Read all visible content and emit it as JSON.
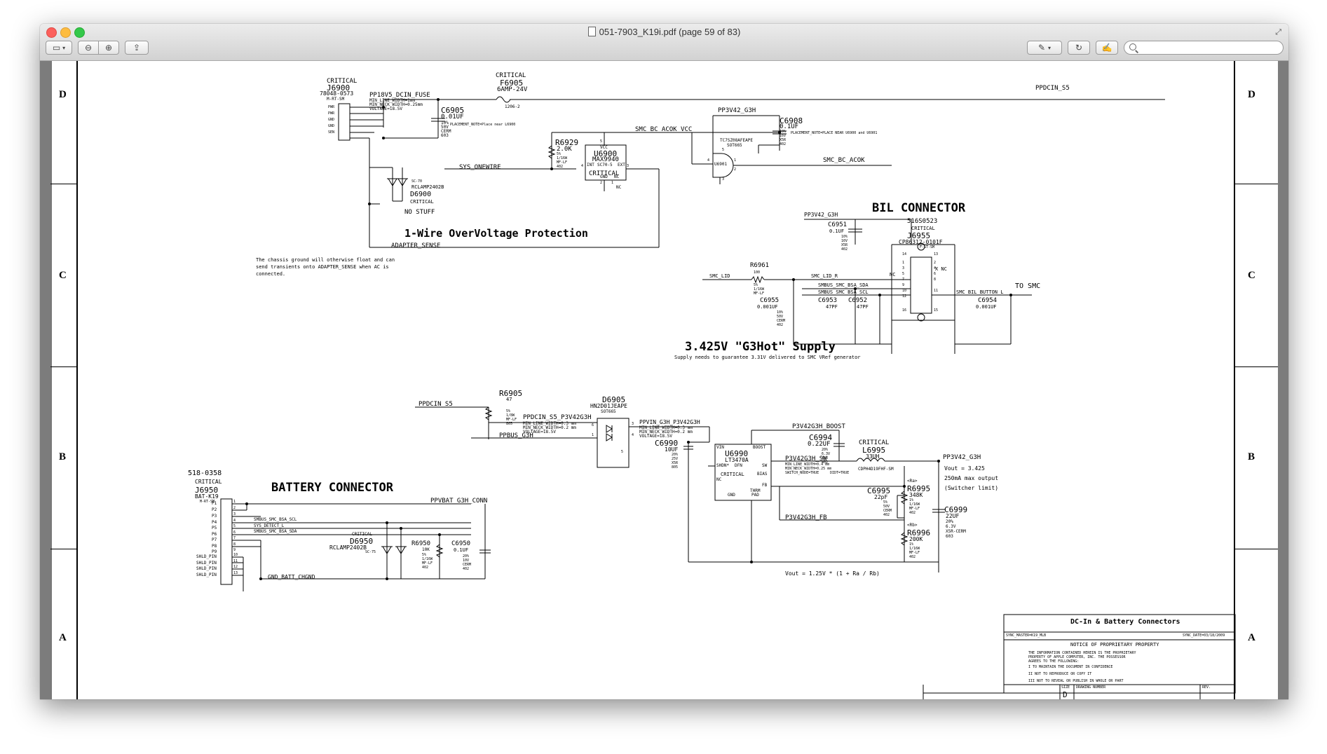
{
  "window": {
    "title": "051-7903_K19i.pdf (page 59 of 83)"
  },
  "zones": {
    "left": [
      "D",
      "C",
      "B",
      "A"
    ],
    "right": [
      "D",
      "C",
      "B",
      "A"
    ]
  },
  "schematic": {
    "dcin": {
      "crit1": "CRITICAL",
      "j6900": "J6900",
      "j6900_part": "78048-0573",
      "j6900_pkg": "M-RT-SM",
      "pins": [
        "PWR",
        "PWR",
        "GND",
        "GND",
        "SEN"
      ],
      "pp18v5": "PP18V5_DCIN_FUSE",
      "pp18v5_a": "MIN_LINE_WIDTH=1mm",
      "pp18v5_b": "MIN_NECK_WIDTH=0.25mm",
      "pp18v5_c": "VOLTAGE=18.5V",
      "crit2": "CRITICAL",
      "f6905": "F6905",
      "f6905_val": "6AMP-24V",
      "f6905_pkg": "1206-2",
      "pp_dcin_s5": "PPDCIN_S5",
      "c6905": "C6905",
      "c6905_val": "0.01UF",
      "c6905_a": "10%",
      "c6905_b": "50V",
      "c6905_c": "CERM",
      "c6905_d": "603",
      "c6905_note": "PLACEMENT_NOTE=Place near L6900",
      "d6900_pkg": "SC-70",
      "d6900_part": "RCLAMP2402B",
      "d6900": "D6900",
      "d6900_crit": "CRITICAL",
      "d6900_nostuff": "NO STUFF",
      "r6929": "R6929",
      "r6929_val": "2.0K",
      "r6929_a": "5%",
      "r6929_b": "1/16W",
      "r6929_c": "MF-LF",
      "r6929_d": "402",
      "smc_bc_acok_vcc": "SMC_BC_ACOK_VCC",
      "sys_onewire": "SYS_ONEWIRE",
      "u6900": "U6900",
      "u6900_part": "MAX9940",
      "u6900_pkg": "SC70-5",
      "u6900_crit": "CRITICAL",
      "u6900_vcc": "VCC",
      "u6900_int": "INT",
      "u6900_ext": "EXT",
      "u6900_gnd": "GND",
      "u6900_nc": "NC",
      "nc": "NC",
      "title_1wire": "1-Wire OverVoltage Protection",
      "adapter_sense": "ADAPTER_SENSE",
      "chassis_note_1": "The chassis ground will otherwise float and can",
      "chassis_note_2": "send transients onto ADAPTER_SENSE when AC is",
      "chassis_note_3": "connected.",
      "pp3v42_g3h": "PP3V42_G3H",
      "c6908": "C6908",
      "c6908_val": "0.1UF",
      "c6908_a": "10%",
      "c6908_b": "16V",
      "c6908_c": "X5R",
      "c6908_d": "402",
      "c6908_note": "PLACEMENT_NOTE=PLACE NEAR U6900 and U6901",
      "u6901_part": "TC7SZ08AFEAPE",
      "u6901_pkg": "SOT665",
      "u6901": "U6901",
      "smc_bc_acok": "SMC_BC_ACOK",
      "u6901_pins": [
        "5",
        "4",
        "1",
        "2",
        "3"
      ],
      "u6900_pins": [
        "5",
        "4",
        "3",
        "2",
        "1"
      ]
    },
    "bil": {
      "title": "BIL CONNECTOR",
      "pp3v42": "PP3V42_G3H",
      "j6955_part": "516S0523",
      "j6955_crit": "CRITICAL",
      "j6955": "J6955",
      "j6955_part2": "CP86312-0101F",
      "j6955_pkg": "F-ST-SM",
      "c6951": "C6951",
      "c6951_val": "0.1UF",
      "c6951_a": "10%",
      "c6951_b": "16V",
      "c6951_c": "X5R",
      "c6951_d": "402",
      "r6961": "R6961",
      "r6961_val": "100",
      "r6961_a": "5%",
      "r6961_b": "1/16W",
      "r6961_c": "MF-LF",
      "smc_lid": "SMC_LID",
      "smc_lid_r": "SMC_LID_R",
      "smbus_sda": "SMBUS_SMC_BSA_SDA",
      "smbus_scl": "SMBUS_SMC_BSA_SCL",
      "smc_bil": "SMC_BIL_BUTTON_L",
      "to_smc": "TO SMC",
      "c6953": "C6953",
      "c6953_val": "47PF",
      "c6952": "C6952",
      "c6952_val": "47PF",
      "c6955": "C6955",
      "c6955_val": "0.001UF",
      "c6954": "C6954",
      "c6954_val": "0.001UF",
      "cap_a": "10%",
      "cap_b": "50V",
      "cap_c": "CERM",
      "cap_d": "402",
      "nc": "NC",
      "x_nc": "X NC",
      "pins_left": [
        "14",
        "1",
        "3",
        "5",
        "7",
        "9",
        "10",
        "12",
        "16"
      ],
      "pins_right": [
        "2",
        "4",
        "6",
        "8",
        "11",
        "13",
        "15"
      ]
    },
    "supply": {
      "title": "3.425V \"G3Hot\" Supply",
      "subtitle": "Supply needs to guarantee 3.31V delivered to SMC VRef generator",
      "ppdcin_s5": "PPDCIN_S5",
      "r6905": "R6905",
      "r6905_val": "47",
      "r6905_a": "5%",
      "r6905_b": "1/8W",
      "r6905_c": "MF-LF",
      "r6905_d": "805",
      "ppdcin_s5_p3v": "PPDCIN_S5_P3V42G3H",
      "ppdcin_a": "MIN_LINE_WIDTH=0.3 mm",
      "ppdcin_b": "MIN_NECK_WIDTH=0.2 mm",
      "ppdcin_c": "VOLTAGE=18.5V",
      "ppbus_g3h": "PPBUS_G3H",
      "d6905": "D6905",
      "d6905_part": "HN2D01JEAPE",
      "d6905_pkg": "SOT665",
      "d6905_pins": [
        "6",
        "1",
        "3",
        "4",
        "5"
      ],
      "ppvin": "PPVIN_G3H_P3V42G3H",
      "ppvin_a": "MIN_LINE_WIDTH=0.3 mm",
      "ppvin_b": "MIN_NECK_WIDTH=0.2 mm",
      "ppvin_c": "VOLTAGE=18.5V",
      "c6990": "C6990",
      "c6990_val": "10UF",
      "c6990_a": "20%",
      "c6990_b": "25V",
      "c6990_c": "X5R",
      "c6990_d": "805",
      "u6990": "U6990",
      "u6990_part": "LT3470A",
      "u6990_pkg": "DFN",
      "u6990_crit": "CRITICAL",
      "u6990_vin": "VIN",
      "u6990_boost": "BOOST",
      "u6990_shdn": "SHDN*",
      "u6990_nc": "NC",
      "u6990_sw": "SW",
      "u6990_bias": "BIAS",
      "u6990_fb": "FB",
      "u6990_gnd": "GND",
      "u6990_therm": "THRM",
      "u6990_pad": "PAD",
      "p3v42g3h_boost": "P3V42G3H_BOOST",
      "c6994": "C6994",
      "c6994_val": "0.22UF",
      "c6994_a": "20%",
      "c6994_b": "6.3V",
      "c6994_c": "X5R",
      "c6994_d": "402",
      "l6995_crit": "CRITICAL",
      "l6995": "L6995",
      "l6995_val": "33UH",
      "l6995_pkg": "CDPH4D19FHF-SM",
      "p3v42g3h_sw": "P3V42G3H_SW",
      "sw_a": "MIN_LINE_WIDTH=0.4 mm",
      "sw_b": "MIN_NECK_WIDTH=0.25 mm",
      "sw_c": "SWITCH_NODE=TRUE",
      "sw_d": "DIDT=TRUE",
      "pp3v42_g3h": "PP3V42_G3H",
      "vout": "Vout = 3.425",
      "vout_max": "250mA max output",
      "vout_sw": "(Switcher limit)",
      "ra": "<Ra>",
      "r6995": "R6995",
      "r6995_val": "348K",
      "r6995_a": "1%",
      "r6995_b": "1/16W",
      "r6995_c": "MF-LF",
      "r6995_d": "402",
      "c6995": "C6995",
      "c6995_val": "22pF",
      "c6995_a": "5%",
      "c6995_b": "50V",
      "c6995_c": "CERM",
      "c6995_d": "402",
      "c6999": "C6999",
      "c6999_val": "22UF",
      "c6999_a": "20%",
      "c6999_b": "6.3V",
      "c6999_c": "X5R-CERM",
      "c6999_d": "603",
      "rb": "<Rb>",
      "r6996": "R6996",
      "r6996_val": "200K",
      "r6996_a": "1%",
      "r6996_b": "1/16W",
      "r6996_c": "MF-LF",
      "r6996_d": "402",
      "p3v42g3h_fb": "P3V42G3H_FB",
      "vout_eq": "Vout = 1.25V * (1 + Ra / Rb)"
    },
    "battery": {
      "part": "518-0358",
      "crit": "CRITICAL",
      "j6950": "J6950",
      "j6950_pkg": "BAT-K19",
      "j6950_pkg2": "M-RT-SM",
      "title": "BATTERY CONNECTOR",
      "pins": [
        "P1",
        "P2",
        "P3",
        "P4",
        "P5",
        "P6",
        "P7",
        "P8",
        "P9",
        "SHLD_PIN",
        "SHLD_PIN",
        "SHLD_PIN",
        "SHLD_PIN"
      ],
      "pin_nums": [
        "1",
        "2",
        "3",
        "4",
        "5",
        "6",
        "7",
        "8",
        "9",
        "10",
        "11",
        "12",
        "13"
      ],
      "ppvbat": "PPVBAT_G3H_CONN",
      "smbus_scl": "SMBUS_SMC_BSA_SCL",
      "sys_detect": "SYS_DETECT_L",
      "smbus_sda": "SMBUS_SMC_BSA_SDA",
      "d6950_crit": "CRITICAL",
      "d6950": "D6950",
      "d6950_part": "RCLAMP2402B",
      "d6950_pkg": "SC-75",
      "r6950": "R6950",
      "r6950_val": "10K",
      "r6950_a": "5%",
      "r6950_b": "1/16W",
      "r6950_c": "MF-LF",
      "r6950_d": "402",
      "c6950": "C6950",
      "c6950_val": "0.1UF",
      "c6950_a": "20%",
      "c6950_b": "10V",
      "c6950_c": "CERM",
      "c6950_d": "402",
      "gnd_batt": "GND_BATT_CHGND"
    },
    "titleblock": {
      "title": "DC-In & Battery Connectors",
      "sync_master": "SYNC_MASTER=K19_MLB",
      "sync_date": "SYNC_DATE=03/18/2009",
      "notice": "NOTICE OF PROPRIETARY PROPERTY",
      "p1": "THE INFORMATION CONTAINED HEREIN IS THE PROPRIETARY",
      "p2": "PROPERTY OF APPLE COMPUTER, INC. THE POSSESSOR",
      "p3": "AGREES TO THE FOLLOWING:",
      "i1": "I TO MAINTAIN THE DOCUMENT IN CONFIDENCE",
      "i2": "II NOT TO REPRODUCE OR COPY IT",
      "i3": "III NOT TO REVEAL OR PUBLISH IN WHOLE OR PART",
      "size": "SIZE",
      "size_val": "D",
      "drawing": "DRAWING NUMBER",
      "rev": "REV."
    }
  }
}
